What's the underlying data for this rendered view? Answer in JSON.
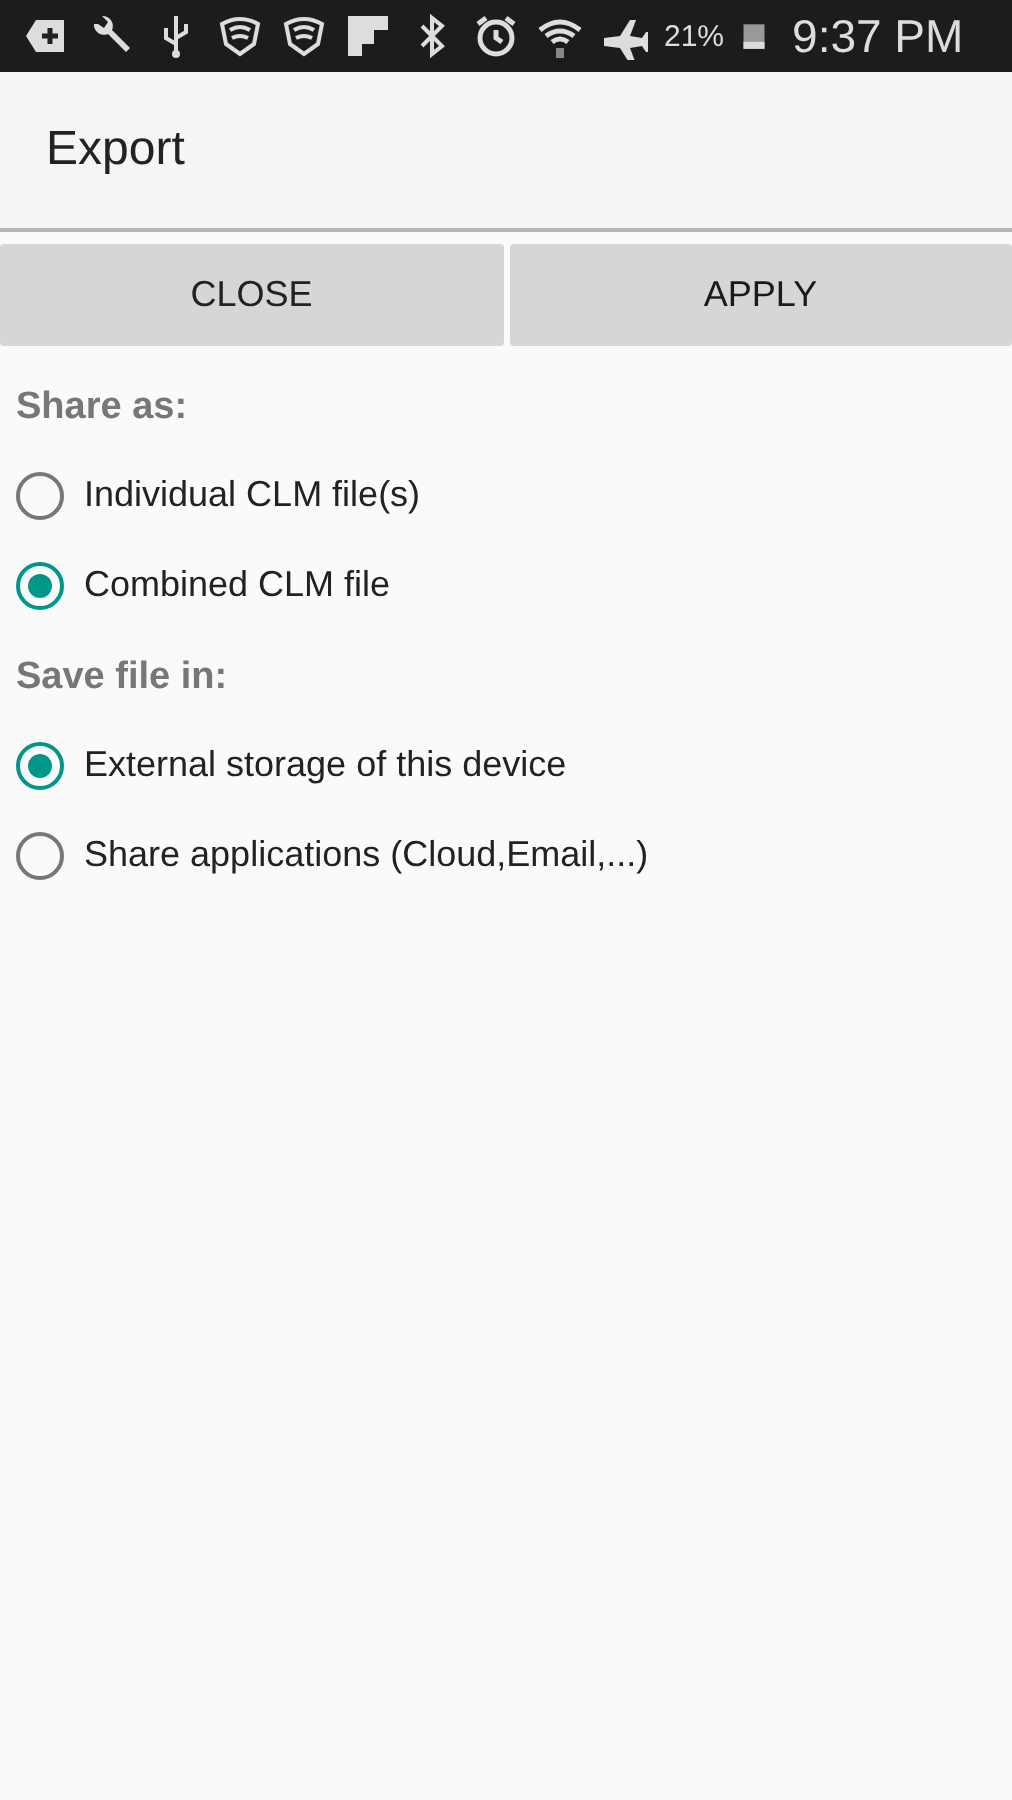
{
  "status_bar": {
    "battery": "21%",
    "time": "9:37 PM"
  },
  "title": "Export",
  "buttons": [
    {
      "label": "CLOSE",
      "kind": "close"
    },
    {
      "label": "APPLY",
      "kind": "apply"
    }
  ],
  "sections": [
    {
      "heading": "Share as:",
      "options": [
        {
          "label": "Individual CLM file(s)",
          "selected": false
        },
        {
          "label": "Combined CLM file",
          "selected": true
        }
      ]
    },
    {
      "heading": "Save file in:",
      "options": [
        {
          "label": "External storage of this device",
          "selected": true
        },
        {
          "label": "Share applications (Cloud,Email,...)",
          "selected": false
        }
      ]
    }
  ]
}
